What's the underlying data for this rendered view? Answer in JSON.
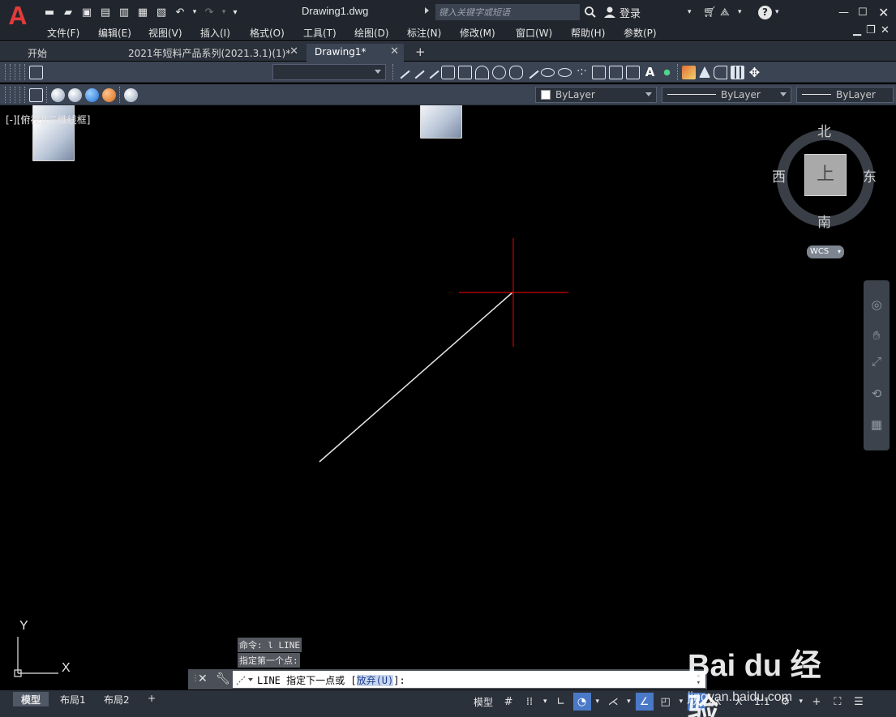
{
  "app": {
    "logo_letter": "A",
    "document_title": "Drawing1.dwg",
    "search_placeholder": "键入关键字或短语",
    "login_label": "登录",
    "brand_color": "#e23b3b"
  },
  "menu": {
    "items": [
      "文件(F)",
      "编辑(E)",
      "视图(V)",
      "插入(I)",
      "格式(O)",
      "工具(T)",
      "绘图(D)",
      "标注(N)",
      "修改(M)",
      "窗口(W)",
      "帮助(H)",
      "参数(P)"
    ]
  },
  "tabs": [
    {
      "label": "开始",
      "active": false,
      "closable": false
    },
    {
      "label": "2021年短料产品系列(2021.3.1)(1)*",
      "active": false,
      "closable": true
    },
    {
      "label": "Drawing1*",
      "active": true,
      "closable": true
    }
  ],
  "toolbar": {
    "view_dropdown_value": "",
    "color_dropdown": "ByLayer",
    "linetype_dropdown": "ByLayer",
    "lineweight_dropdown": "ByLayer"
  },
  "viewport": {
    "label": "[-][俯视][二维线框]",
    "crosshair_color": "#cc0000",
    "line_color": "#e6e6e6"
  },
  "viewcube": {
    "north": "北",
    "south": "南",
    "east": "东",
    "west": "西",
    "face": "上",
    "wcs_label": "WCS"
  },
  "ucs": {
    "x_label": "X",
    "y_label": "Y"
  },
  "command": {
    "history": [
      "命令: l LINE",
      "指定第一个点:"
    ],
    "prompt_prefix": "LINE 指定下一点或 [",
    "prompt_option": "放弃(U)",
    "prompt_suffix": "]:"
  },
  "status": {
    "layout_tabs": [
      {
        "label": "模型",
        "active": true
      },
      {
        "label": "布局1",
        "active": false
      },
      {
        "label": "布局2",
        "active": false
      }
    ],
    "model_label": "模型",
    "scale_label": "1:1"
  },
  "watermark": {
    "brand": "Bai du 经验",
    "url": "jingyan.baidu.com"
  }
}
